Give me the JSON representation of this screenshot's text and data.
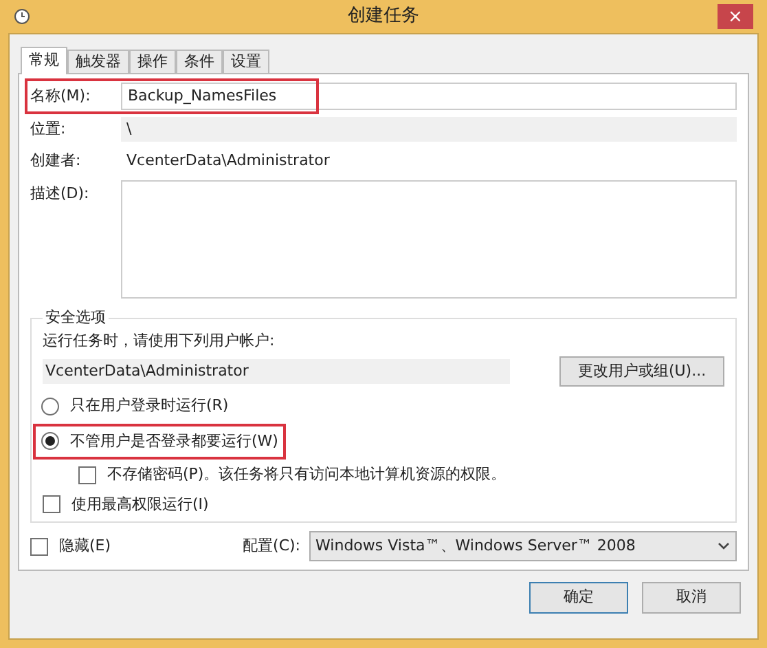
{
  "window": {
    "title": "创建任务",
    "close": "×"
  },
  "tabs": [
    {
      "label": "常规",
      "selected": true
    },
    {
      "label": "触发器",
      "selected": false
    },
    {
      "label": "操作",
      "selected": false
    },
    {
      "label": "条件",
      "selected": false
    },
    {
      "label": "设置",
      "selected": false
    }
  ],
  "name_field": {
    "label": "名称(M):",
    "value": "Backup_NamesFiles",
    "highlighted": true
  },
  "location": {
    "label": "位置:",
    "value": "\\"
  },
  "author": {
    "label": "创建者:",
    "value": "VcenterData\\Administrator"
  },
  "description": {
    "label": "描述(D):"
  },
  "security": {
    "title": "安全选项",
    "prompt": "运行任务时，请使用下列用户帐户:",
    "account": "VcenterData\\Administrator",
    "change_button": "更改用户或组(U)...",
    "radios": [
      {
        "label": "只在用户登录时运行(R)",
        "selected": false,
        "highlighted": false
      },
      {
        "label": "不管用户是否登录都要运行(W)",
        "selected": true,
        "highlighted": true
      }
    ],
    "no_password": {
      "label": "不存储密码(P)。该任务将只有访问本地计算机资源的权限。",
      "checked": false
    },
    "highest": {
      "label": "使用最高权限运行(I)",
      "checked": false
    }
  },
  "hidden": {
    "label": "隐藏(E)",
    "checked": false
  },
  "config": {
    "label": "配置(C):",
    "value": "Windows Vista™、Windows Server™ 2008"
  },
  "buttons": [
    {
      "label": "确定",
      "selected": true
    },
    {
      "label": "取消",
      "selected": false
    }
  ]
}
